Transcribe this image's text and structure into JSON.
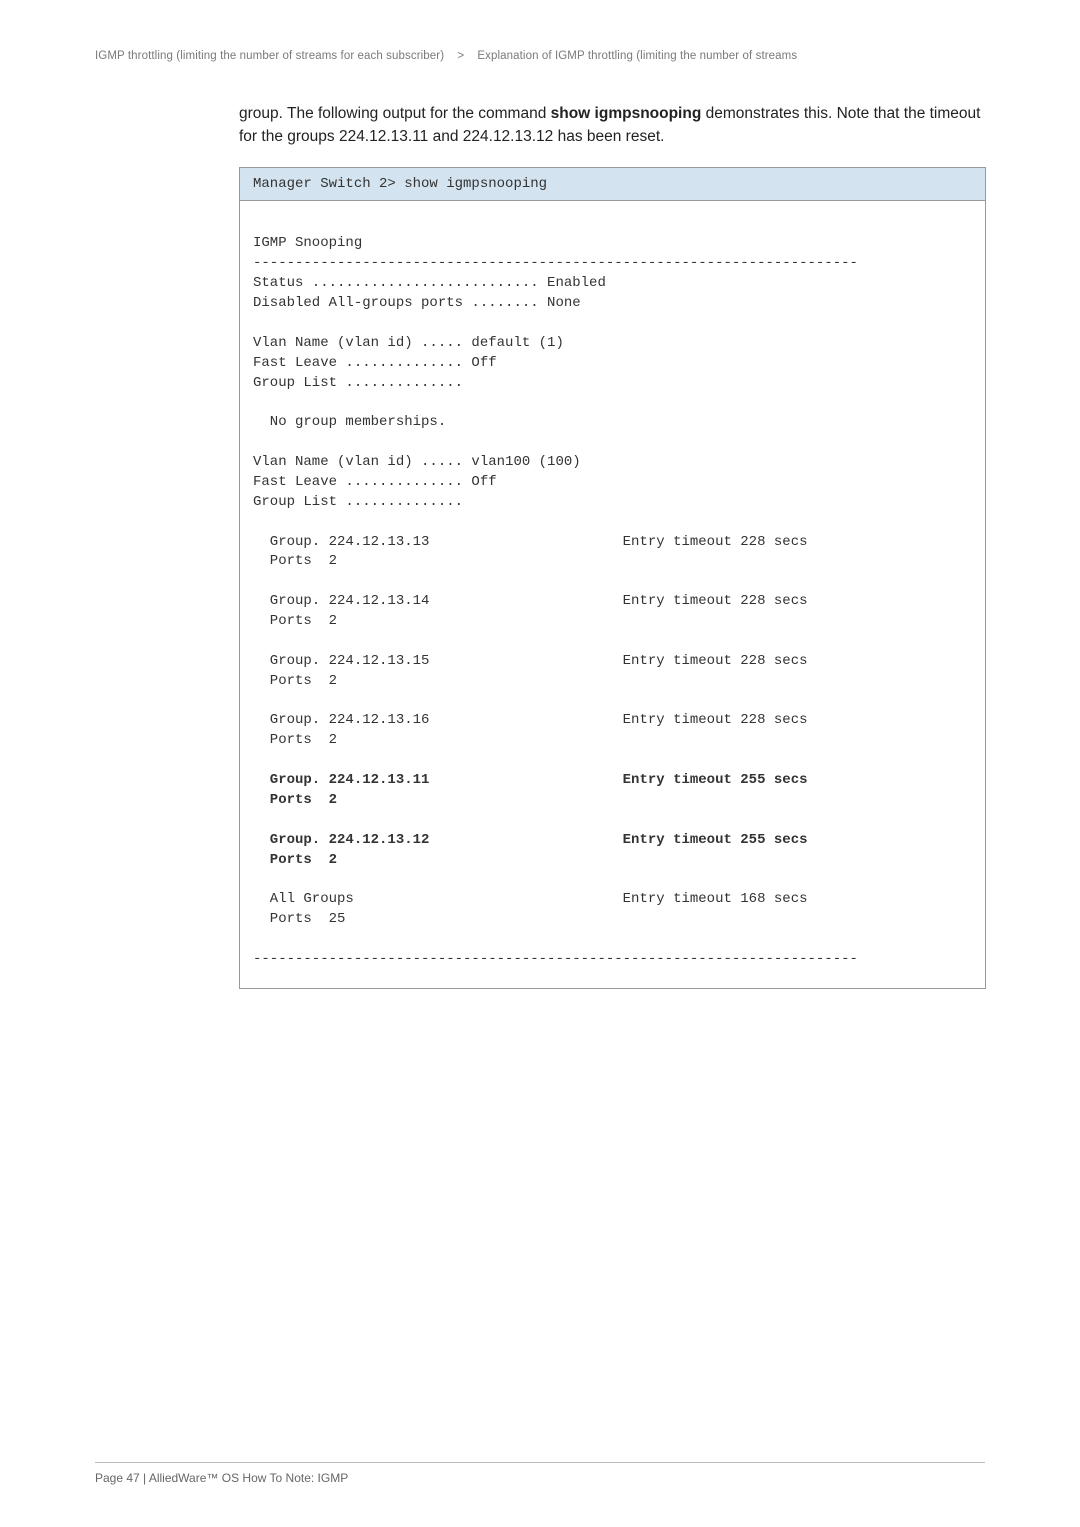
{
  "breadcrumb": {
    "left": "IGMP throttling (limiting the number of streams for each subscriber)",
    "sep": ">",
    "right": "Explanation of IGMP throttling (limiting the number of streams"
  },
  "intro": {
    "part1": "group. The following output for the command ",
    "cmd": "show igmpsnooping",
    "part2": " demonstrates this. Note that the timeout for the groups 224.12.13.11 and 224.12.13.12 has been reset."
  },
  "terminal": {
    "header": "Manager Switch 2> show igmpsnooping",
    "lines": {
      "l01": "IGMP Snooping",
      "l02": "------------------------------------------------------------------------",
      "l03": "Status ........................... Enabled",
      "l04": "Disabled All-groups ports ........ None",
      "l05": " ",
      "l06": "Vlan Name (vlan id) ..... default (1)",
      "l07": "Fast Leave .............. Off",
      "l08": "Group List ..............",
      "l09": " ",
      "l10": "  No group memberships.",
      "l11": " ",
      "l12": "Vlan Name (vlan id) ..... vlan100 (100)",
      "l13": "Fast Leave .............. Off",
      "l14": "Group List ..............",
      "l15": " ",
      "l16": "  Group. 224.12.13.13                       Entry timeout 228 secs",
      "l17": "  Ports  2",
      "l18": " ",
      "l19": "  Group. 224.12.13.14                       Entry timeout 228 secs",
      "l20": "  Ports  2",
      "l21": " ",
      "l22": "  Group. 224.12.13.15                       Entry timeout 228 secs",
      "l23": "  Ports  2",
      "l24": " ",
      "l25": "  Group. 224.12.13.16                       Entry timeout 228 secs",
      "l26": "  Ports  2",
      "l27": " ",
      "l28": "  Group. 224.12.13.11                       Entry timeout 255 secs",
      "l29": "  Ports  2",
      "l30": " ",
      "l31": "  Group. 224.12.13.12                       Entry timeout 255 secs",
      "l32": "  Ports  2",
      "l33": " ",
      "l34": "  All Groups                                Entry timeout 168 secs",
      "l35": "  Ports  25",
      "l36": " ",
      "l37": "------------------------------------------------------------------------"
    }
  },
  "footer": "Page 47 | AlliedWare™ OS How To Note: IGMP"
}
